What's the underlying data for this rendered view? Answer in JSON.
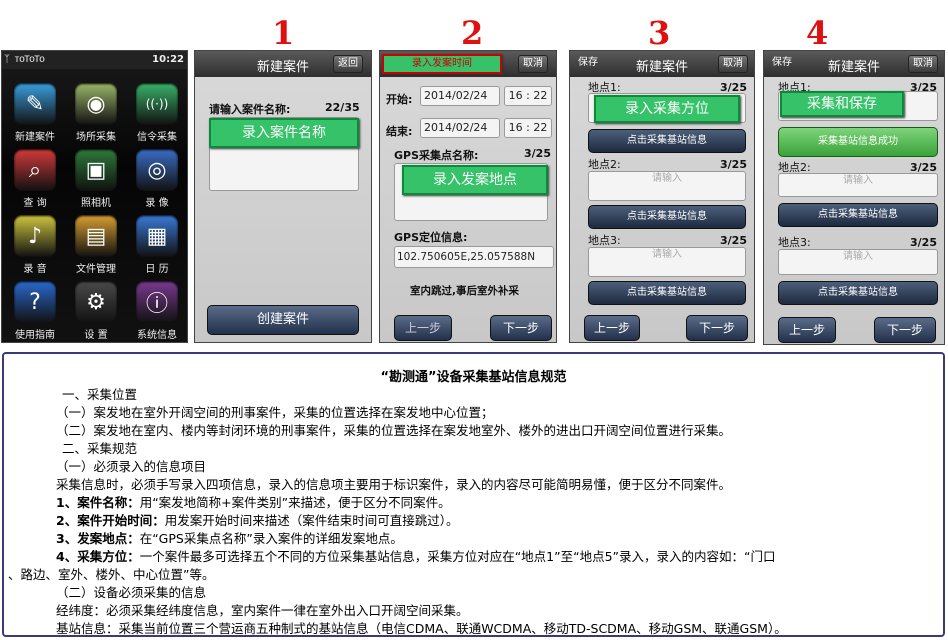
{
  "steps": [
    "1",
    "2",
    "3",
    "4"
  ],
  "home": {
    "status_left": "ᛉ ᴛᴏTᴏTᴏ",
    "time": "10:22",
    "apps": [
      {
        "label": "新建案件",
        "icon": "new-case-icon",
        "color": "#3aa0e0"
      },
      {
        "label": "场所采集",
        "icon": "satellite-icon",
        "color": "#9bb86a"
      },
      {
        "label": "信令采集",
        "icon": "signal-icon",
        "color": "#3ab36a"
      },
      {
        "label": "查 询",
        "icon": "query-icon",
        "color": "#d43a3a"
      },
      {
        "label": "照相机",
        "icon": "camera-icon",
        "color": "#2d7a3a"
      },
      {
        "label": "录 像",
        "icon": "video-icon",
        "color": "#3a6ec8"
      },
      {
        "label": "录 音",
        "icon": "mic-icon",
        "color": "#d0c640"
      },
      {
        "label": "文件管理",
        "icon": "folder-icon",
        "color": "#d8a030"
      },
      {
        "label": "日 历",
        "icon": "calendar-icon",
        "color": "#3a7ad8"
      },
      {
        "label": "使用指南",
        "icon": "help-icon",
        "color": "#2a6ad0"
      },
      {
        "label": "设 置",
        "icon": "gear-icon",
        "color": "#4a4a4a"
      },
      {
        "label": "系统信息",
        "icon": "info-icon",
        "color": "#7a3a90"
      }
    ]
  },
  "screen1": {
    "title": "新建案件",
    "back": "返回",
    "prompt": "请输入案件名称:",
    "counter": "22/35",
    "annotation": "录入案件名称",
    "create_button": "创建案件"
  },
  "screen2": {
    "annotation_top": "录入发案时间",
    "cancel": "取消",
    "start_label": "开始:",
    "start_date": "2014/02/24",
    "start_time": "16 : 22",
    "end_label": "结束:",
    "end_date": "2014/02/24",
    "end_time": "16 : 22",
    "gps_name_label": "GPS采集点名称:",
    "gps_counter": "3/25",
    "annotation_place": "录入发案地点",
    "gps_pos_label": "GPS定位信息:",
    "gps_coords": "102.750605E,25.057588N",
    "note": "室内跳过,事后室外补采",
    "prev": "上一步",
    "next": "下一步"
  },
  "screen3": {
    "save": "保存",
    "title": "新建案件",
    "cancel": "取消",
    "point1_label": "地点1:",
    "point1_counter": "3/25",
    "annotation": "录入采集方位",
    "collect_btn": "点击采集基站信息",
    "point2_label": "地点2:",
    "point2_counter": "3/25",
    "placeholder": "请输入",
    "point3_label": "地点3:",
    "point3_counter": "3/25",
    "prev": "上一步",
    "next": "下一步"
  },
  "screen4": {
    "save": "保存",
    "title": "新建案件",
    "cancel": "取消",
    "point1_label": "地点1:",
    "point1_counter": "3/25",
    "annotation": "采集和保存",
    "success_btn": "采集基站信息成功",
    "point2_label": "地点2:",
    "point2_counter": "3/25",
    "placeholder": "请输入",
    "collect_btn": "点击采集基站信息",
    "point3_label": "地点3:",
    "point3_counter": "3/25",
    "prev": "上一步",
    "next": "下一步"
  },
  "doc": {
    "title": "“勘测通”设备采集基站信息规范",
    "s1": "一、采集位置",
    "s1_1": "（一）案发地在室外开阔空间的刑事案件，采集的位置选择在案发地中心位置；",
    "s1_2": "（二）案发地在室内、楼内等封闭环境的刑事案件，采集的位置选择在案发地室外、楼外的进出口开阔空间位置进行采集。",
    "s2": "二、采集规范",
    "s2_1": "（一）必须录入的信息项目",
    "s2_1_desc": "采集信息时，必须手写录入四项信息，录入的信息项主要用于标识案件，录入的内容尽可能简明易懂，便于区分不同案件。",
    "item1_key": "1、案件名称：",
    "item1_val": "用“案发地简称+案件类别”来描述，便于区分不同案件。",
    "item2_key": "2、案件开始时间：",
    "item2_val": "用发案开始时间来描述（案件结束时间可直接跳过）。",
    "item3_key": "3、发案地点：",
    "item3_val": "在“GPS采集点名称”录入案件的详细发案地点。",
    "item4_key": "4、采集方位：",
    "item4_val": "一个案件最多可选择五个不同的方位采集基站信息，采集方位对应在“地点1”至“地点5”录入，录入的内容如：“门口",
    "item4_cont": "、路边、室外、楼外、中心位置”等。",
    "s2_2": "（二）设备必须采集的信息",
    "lonlat": "经纬度：必须采集经纬度信息，室内案件一律在室外出入口开阔空间采集。",
    "station": "基站信息：采集当前位置三个营运商五种制式的基站信息（电信CDMA、联通WCDMA、移动TD-SCDMA、移动GSM、联通GSM）。"
  }
}
